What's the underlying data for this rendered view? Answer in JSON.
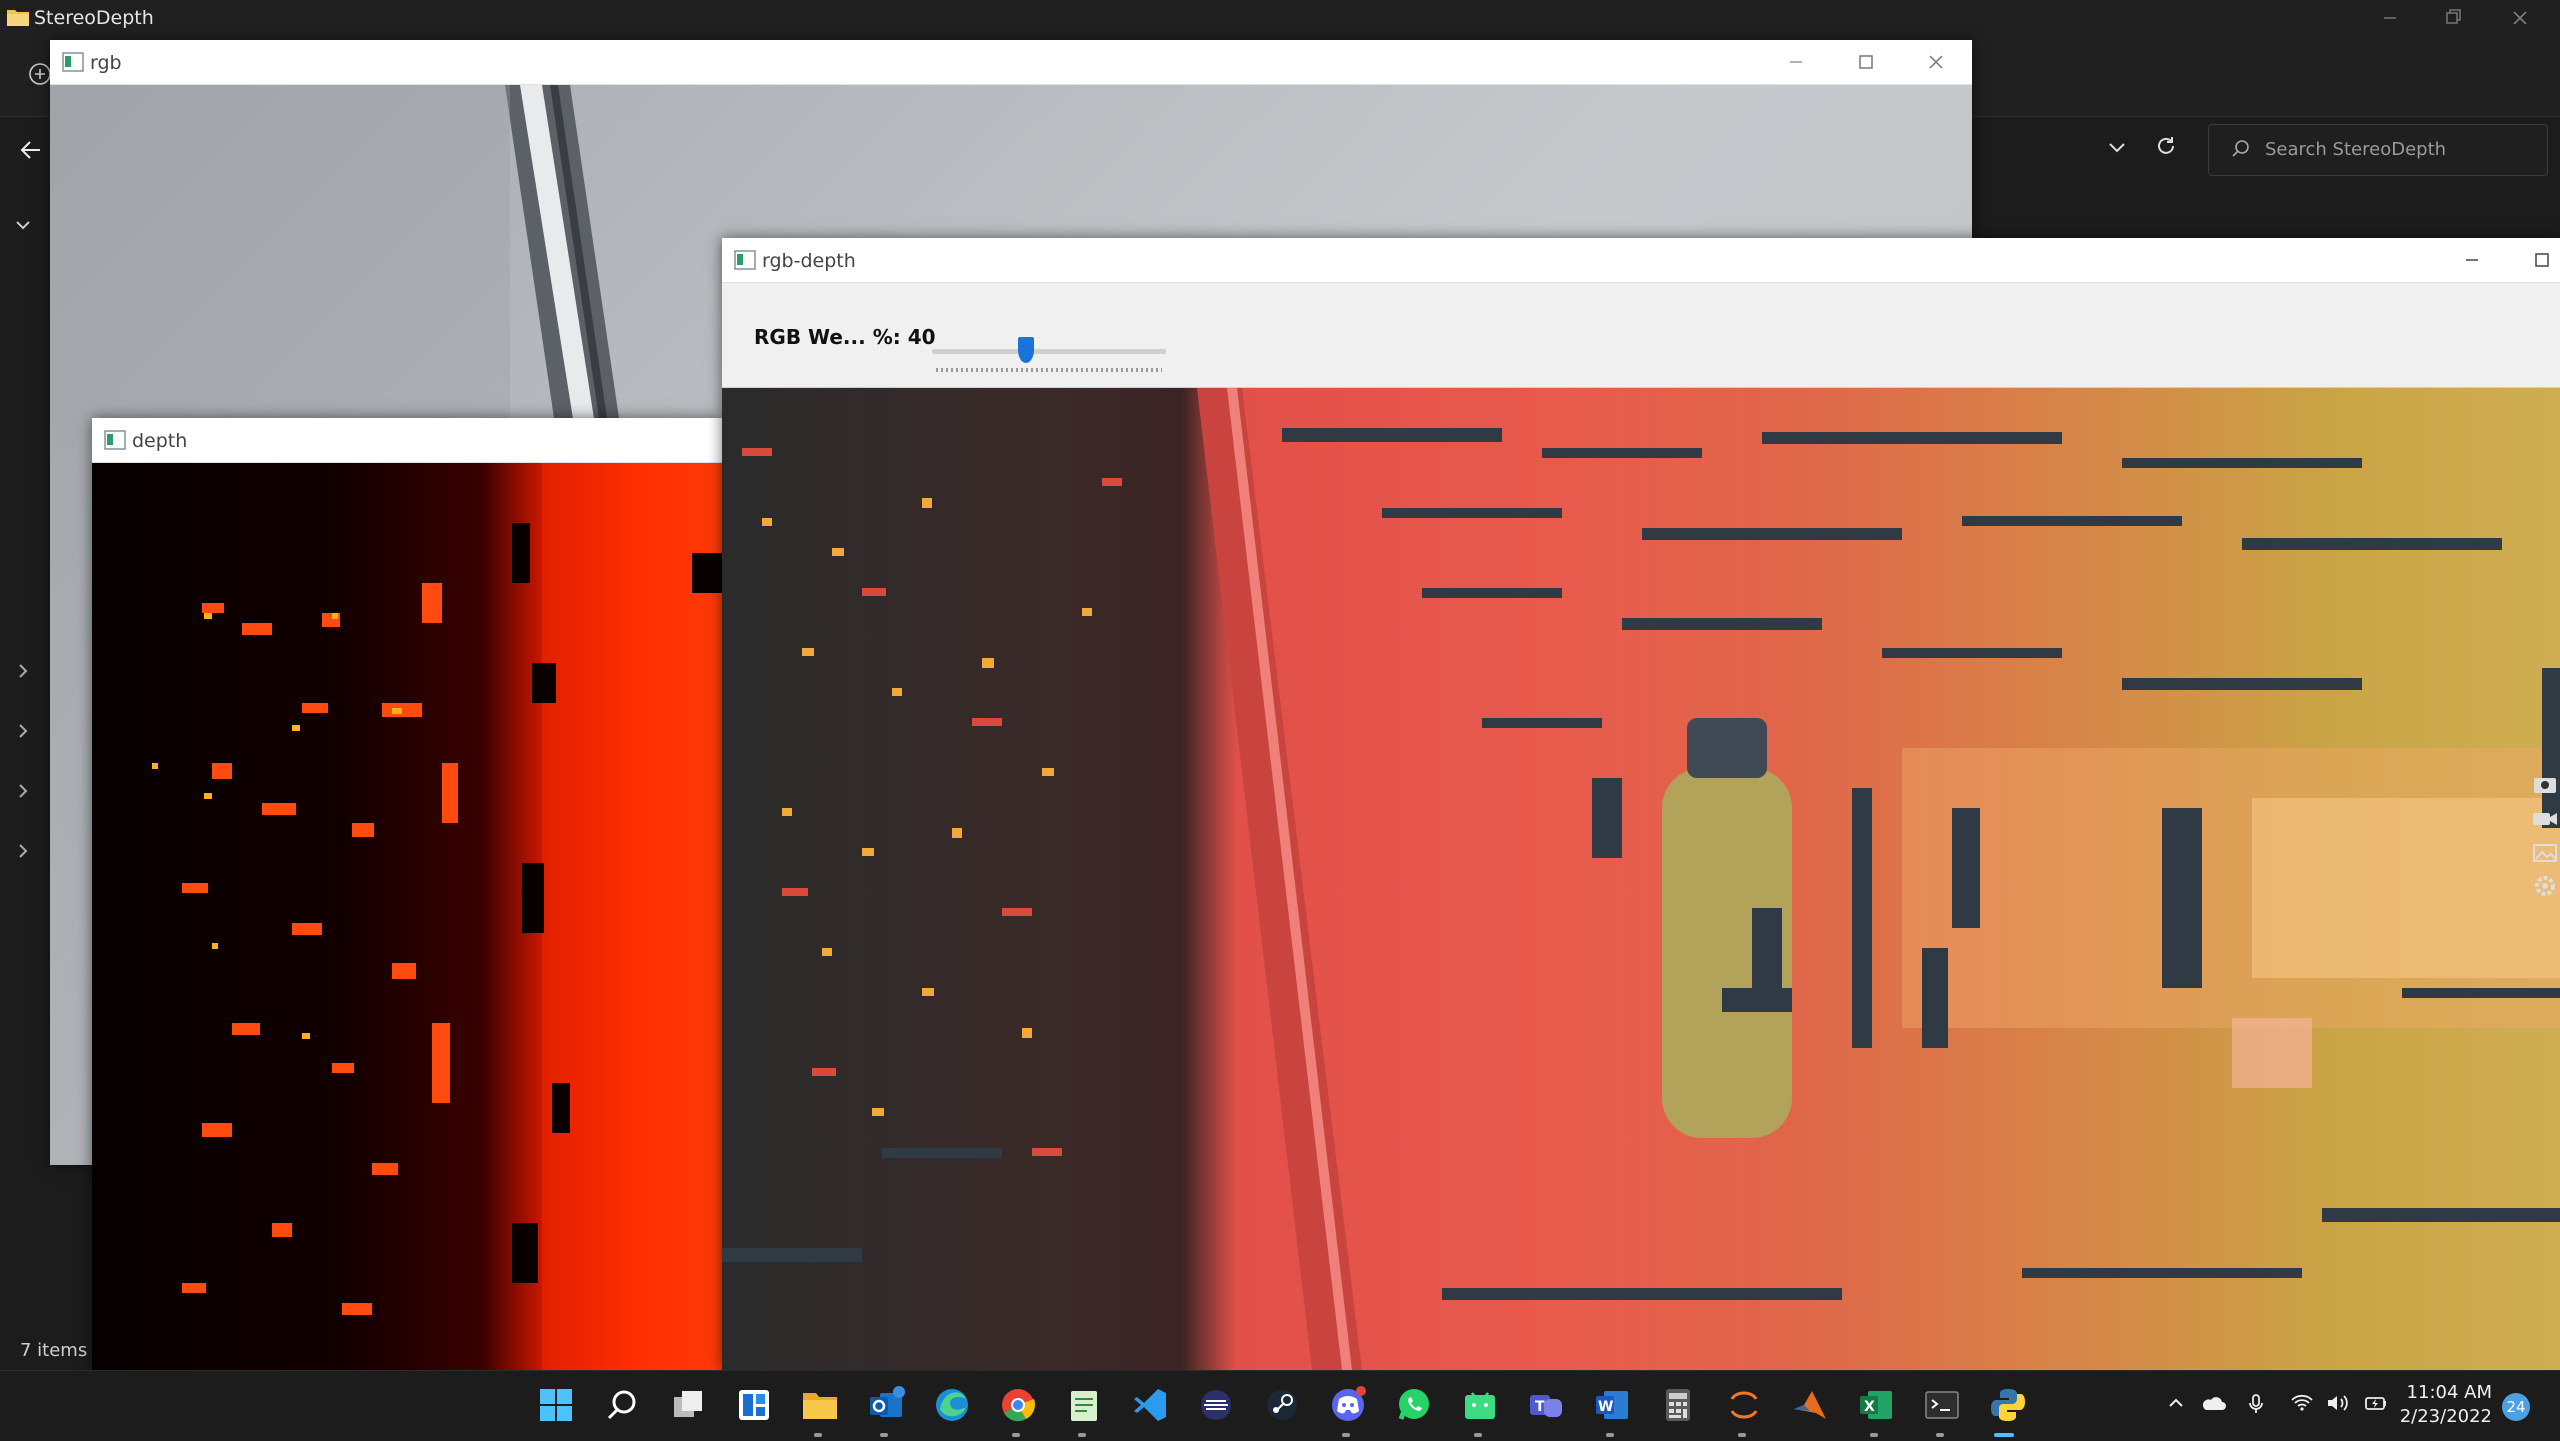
{
  "explorer": {
    "title": "StereoDepth",
    "search_placeholder": "Search StereoDepth",
    "status": "7 items"
  },
  "windows": {
    "rgb": {
      "title": "rgb"
    },
    "depth": {
      "title": "depth"
    },
    "rgb_depth": {
      "title": "rgb-depth",
      "slider_label": "RGB We... %: 40",
      "slider_value_percent": 40
    }
  },
  "taskbar": {
    "apps": [
      "start",
      "search",
      "task-view",
      "widgets",
      "file-explorer",
      "outlook",
      "edge",
      "chrome",
      "notepad",
      "vscode",
      "terminal-app",
      "steam",
      "discord",
      "whatsapp",
      "android-studio",
      "teams",
      "word",
      "calculator",
      "jupyter",
      "matlab",
      "excel",
      "terminal",
      "python"
    ],
    "time": "11:04 AM",
    "date": "2/23/2022",
    "notification_count": "24"
  },
  "colors": {
    "accent": "#1a73d9",
    "taskbar_bg": "#1c1c1c",
    "window_bg": "#ffffff"
  }
}
